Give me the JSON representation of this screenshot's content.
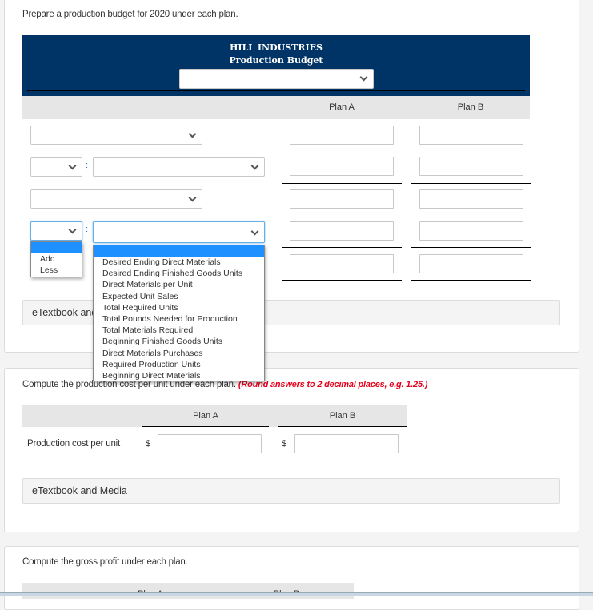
{
  "section1": {
    "prompt": "Prepare a production budget for 2020 under each plan.",
    "company": "HILL INDUSTRIES",
    "title": "Production Budget",
    "period_select_value": "",
    "columns": [
      "Plan A",
      "Plan B"
    ],
    "rows": [
      {
        "type": "select",
        "label_value": "",
        "plan_a": "",
        "plan_b": ""
      },
      {
        "type": "op-select",
        "op_value": "",
        "label_value": "",
        "plan_a": "",
        "plan_b": ""
      },
      {
        "type": "select",
        "label_value": "",
        "plan_a": "",
        "plan_b": ""
      },
      {
        "type": "op-select",
        "op_value": "",
        "label_value": "",
        "plan_a": "",
        "plan_b": ""
      },
      {
        "type": "total",
        "plan_a": "",
        "plan_b": ""
      }
    ],
    "op_dropdown_options": [
      "",
      "Add",
      "Less"
    ],
    "label_dropdown_options": [
      "",
      "Desired Ending Direct Materials",
      "Desired Ending Finished Goods Units",
      "Direct Materials per Unit",
      "Expected Unit Sales",
      "Total Required Units",
      "Total Pounds Needed for Production",
      "Total Materials Required",
      "Beginning Finished Goods Units",
      "Direct Materials Purchases",
      "Required Production Units",
      "Beginning Direct Materials"
    ],
    "etextbook": "eTextbook and Media",
    "colon": ":"
  },
  "section2": {
    "prompt": "Compute the production cost per unit under each plan.",
    "hint": "(Round answers to 2 decimal places, e.g. 1.25.)",
    "columns": [
      "Plan A",
      "Plan B"
    ],
    "row_label": "Production cost per unit",
    "currency": "$",
    "plan_a": "",
    "plan_b": "",
    "etextbook": "eTextbook and Media"
  },
  "section3": {
    "prompt": "Compute the gross profit under each plan.",
    "columns": [
      "Plan A",
      "Plan B"
    ]
  }
}
